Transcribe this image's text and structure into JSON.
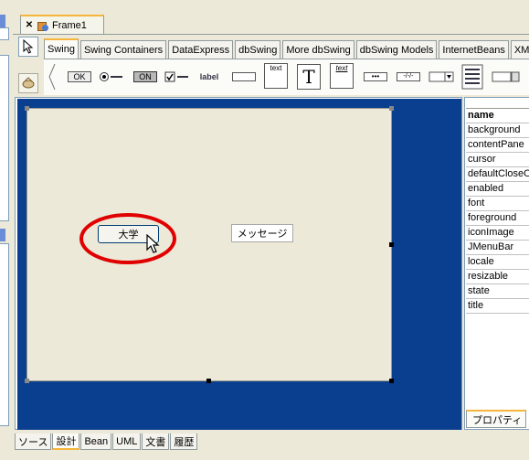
{
  "window": {
    "frame_tab_label": "Frame1"
  },
  "palette": {
    "tabs": [
      "Swing",
      "Swing Containers",
      "DataExpress",
      "dbSwing",
      "More dbSwing",
      "dbSwing Models",
      "InternetBeans",
      "XM"
    ],
    "active_tab": "Swing",
    "components": {
      "button_label": "OK",
      "toggle_label": "ON",
      "label_label": "label",
      "textarea_label": "text",
      "textpane_label": "T",
      "editorpane_label": "text",
      "password_label": "•••",
      "formatted_label": "-/-/-"
    }
  },
  "design": {
    "button_text": "大学",
    "label_text": "メッセージ"
  },
  "properties": {
    "header": "name",
    "rows": [
      "background",
      "contentPane",
      "cursor",
      "defaultCloseO",
      "enabled",
      "font",
      "foreground",
      "iconImage",
      "JMenuBar",
      "locale",
      "resizable",
      "state",
      "title"
    ],
    "tab_label": "プロパティ"
  },
  "bottom_tabs": [
    "ソース",
    "設計",
    "Bean",
    "UML",
    "文書",
    "履歴"
  ],
  "colors": {
    "design_background": "#0a3f8f",
    "annotation": "#e00000",
    "tab_accent": "#f6b53b"
  }
}
